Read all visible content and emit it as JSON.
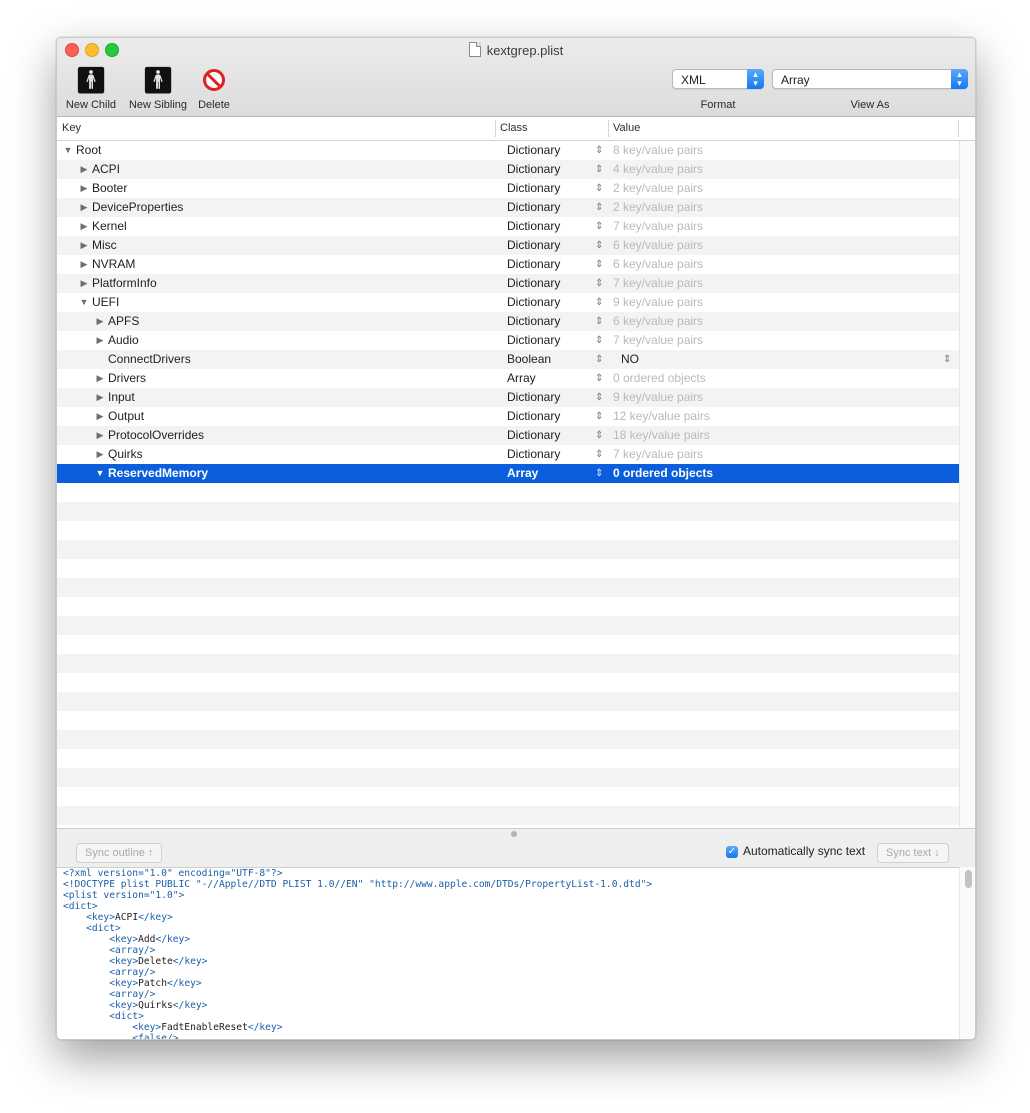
{
  "window": {
    "title": "kextgrep.plist"
  },
  "toolbar": {
    "new_child": "New Child",
    "new_sibling": "New Sibling",
    "delete": "Delete",
    "format_value": "XML",
    "format_label": "Format",
    "view_as_value": "Array",
    "view_as_label": "View As"
  },
  "columns": {
    "key": "Key",
    "class": "Class",
    "value": "Value"
  },
  "rows": [
    {
      "key": "Root",
      "cls": "Dictionary",
      "val": "8 key/value pairs",
      "depth": 0,
      "state": "expanded"
    },
    {
      "key": "ACPI",
      "cls": "Dictionary",
      "val": "4 key/value pairs",
      "depth": 1,
      "state": "collapsed"
    },
    {
      "key": "Booter",
      "cls": "Dictionary",
      "val": "2 key/value pairs",
      "depth": 1,
      "state": "collapsed"
    },
    {
      "key": "DeviceProperties",
      "cls": "Dictionary",
      "val": "2 key/value pairs",
      "depth": 1,
      "state": "collapsed"
    },
    {
      "key": "Kernel",
      "cls": "Dictionary",
      "val": "7 key/value pairs",
      "depth": 1,
      "state": "collapsed"
    },
    {
      "key": "Misc",
      "cls": "Dictionary",
      "val": "6 key/value pairs",
      "depth": 1,
      "state": "collapsed"
    },
    {
      "key": "NVRAM",
      "cls": "Dictionary",
      "val": "6 key/value pairs",
      "depth": 1,
      "state": "collapsed"
    },
    {
      "key": "PlatformInfo",
      "cls": "Dictionary",
      "val": "7 key/value pairs",
      "depth": 1,
      "state": "collapsed"
    },
    {
      "key": "UEFI",
      "cls": "Dictionary",
      "val": "9 key/value pairs",
      "depth": 1,
      "state": "expanded"
    },
    {
      "key": "APFS",
      "cls": "Dictionary",
      "val": "6 key/value pairs",
      "depth": 2,
      "state": "collapsed"
    },
    {
      "key": "Audio",
      "cls": "Dictionary",
      "val": "7 key/value pairs",
      "depth": 2,
      "state": "collapsed"
    },
    {
      "key": "ConnectDrivers",
      "cls": "Boolean",
      "val": "NO",
      "depth": 2,
      "state": "leaf",
      "editable": true
    },
    {
      "key": "Drivers",
      "cls": "Array",
      "val": "0 ordered objects",
      "depth": 2,
      "state": "collapsed"
    },
    {
      "key": "Input",
      "cls": "Dictionary",
      "val": "9 key/value pairs",
      "depth": 2,
      "state": "collapsed"
    },
    {
      "key": "Output",
      "cls": "Dictionary",
      "val": "12 key/value pairs",
      "depth": 2,
      "state": "collapsed"
    },
    {
      "key": "ProtocolOverrides",
      "cls": "Dictionary",
      "val": "18 key/value pairs",
      "depth": 2,
      "state": "collapsed"
    },
    {
      "key": "Quirks",
      "cls": "Dictionary",
      "val": "7 key/value pairs",
      "depth": 2,
      "state": "collapsed"
    },
    {
      "key": "ReservedMemory",
      "cls": "Array",
      "val": "0 ordered objects",
      "depth": 2,
      "state": "expanded",
      "selected": true
    }
  ],
  "sync": {
    "outline_button": "Sync outline ↑",
    "auto_label": "Automatically sync text",
    "auto_checked": true,
    "text_button": "Sync text ↓"
  },
  "xml_lines": [
    {
      "indent": 0,
      "parts": [
        {
          "t": "tag",
          "s": "<?xml version=\"1.0\" encoding=\"UTF-8\"?>"
        }
      ]
    },
    {
      "indent": 0,
      "parts": [
        {
          "t": "tag",
          "s": "<!DOCTYPE plist PUBLIC \"-//Apple//DTD PLIST 1.0//EN\" \"http://www.apple.com/DTDs/PropertyList-1.0.dtd\">"
        }
      ]
    },
    {
      "indent": 0,
      "parts": [
        {
          "t": "tag",
          "s": "<plist version=\"1.0\">"
        }
      ]
    },
    {
      "indent": 0,
      "parts": [
        {
          "t": "tag",
          "s": "<dict>"
        }
      ]
    },
    {
      "indent": 1,
      "parts": [
        {
          "t": "tag",
          "s": "<key>"
        },
        {
          "t": "txt",
          "s": "ACPI"
        },
        {
          "t": "tag",
          "s": "</key>"
        }
      ]
    },
    {
      "indent": 1,
      "parts": [
        {
          "t": "tag",
          "s": "<dict>"
        }
      ]
    },
    {
      "indent": 2,
      "parts": [
        {
          "t": "tag",
          "s": "<key>"
        },
        {
          "t": "txt",
          "s": "Add"
        },
        {
          "t": "tag",
          "s": "</key>"
        }
      ]
    },
    {
      "indent": 2,
      "parts": [
        {
          "t": "tag",
          "s": "<array/>"
        }
      ]
    },
    {
      "indent": 2,
      "parts": [
        {
          "t": "tag",
          "s": "<key>"
        },
        {
          "t": "txt",
          "s": "Delete"
        },
        {
          "t": "tag",
          "s": "</key>"
        }
      ]
    },
    {
      "indent": 2,
      "parts": [
        {
          "t": "tag",
          "s": "<array/>"
        }
      ]
    },
    {
      "indent": 2,
      "parts": [
        {
          "t": "tag",
          "s": "<key>"
        },
        {
          "t": "txt",
          "s": "Patch"
        },
        {
          "t": "tag",
          "s": "</key>"
        }
      ]
    },
    {
      "indent": 2,
      "parts": [
        {
          "t": "tag",
          "s": "<array/>"
        }
      ]
    },
    {
      "indent": 2,
      "parts": [
        {
          "t": "tag",
          "s": "<key>"
        },
        {
          "t": "txt",
          "s": "Quirks"
        },
        {
          "t": "tag",
          "s": "</key>"
        }
      ]
    },
    {
      "indent": 2,
      "parts": [
        {
          "t": "tag",
          "s": "<dict>"
        }
      ]
    },
    {
      "indent": 3,
      "parts": [
        {
          "t": "tag",
          "s": "<key>"
        },
        {
          "t": "txt",
          "s": "FadtEnableReset"
        },
        {
          "t": "tag",
          "s": "</key>"
        }
      ]
    },
    {
      "indent": 3,
      "parts": [
        {
          "t": "tag",
          "s": "<false/>"
        }
      ]
    }
  ],
  "colors": {
    "selection": "#0b5fdc",
    "alt_row": "#f3f3f3",
    "xml_tag": "#1b5fa8",
    "accent": "#1677f1"
  },
  "icons": {
    "new_child": "person-child-icon",
    "new_sibling": "person-sibling-icon",
    "delete": "prohibited-icon",
    "popup": "up-down-chevron-icon"
  }
}
